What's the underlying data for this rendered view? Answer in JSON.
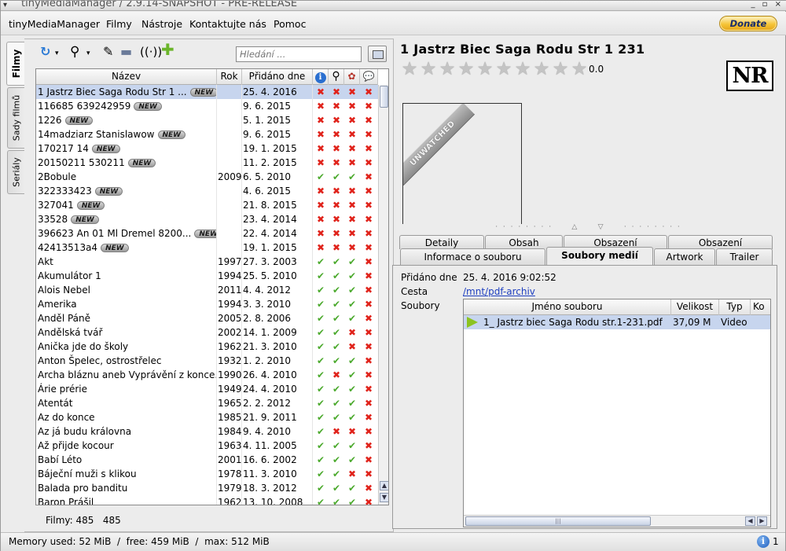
{
  "window": {
    "title": "tinyMediaManager / 2.9.14-SNAPSHOT - PRE-RELEASE",
    "controls": "_ ▫ ×"
  },
  "menu": {
    "items": [
      "tinyMediaManager",
      "Filmy",
      "Nástroje",
      "Kontaktujte nás",
      "Pomoc"
    ],
    "donate": "Donate"
  },
  "side_tabs": [
    "Filmy",
    "Sady filmů",
    "Seriály"
  ],
  "search": {
    "placeholder": "Hledání ..."
  },
  "table": {
    "headers": {
      "name": "Název",
      "year": "Rok",
      "added": "Přidáno dne"
    },
    "new_badge": "NEW",
    "rows": [
      {
        "name": "1 Jastrz Biec Saga Rodu Str 1 ...",
        "new": true,
        "year": "",
        "date": "25. 4. 2016",
        "f": "xxxx",
        "sel": true
      },
      {
        "name": "116685 639242959",
        "new": true,
        "year": "",
        "date": "9. 6. 2015",
        "f": "xxxx"
      },
      {
        "name": "1226",
        "new": true,
        "year": "",
        "date": "5. 1. 2015",
        "f": "xxxx"
      },
      {
        "name": "14madziarz Stanislawow",
        "new": true,
        "year": "",
        "date": "9. 6. 2015",
        "f": "xxxx"
      },
      {
        "name": "170217 14",
        "new": true,
        "year": "",
        "date": "19. 1. 2015",
        "f": "xxxx"
      },
      {
        "name": "20150211 530211",
        "new": true,
        "year": "",
        "date": "11. 2. 2015",
        "f": "xxxx"
      },
      {
        "name": "2Bobule",
        "new": false,
        "year": "2009",
        "date": "6. 5. 2010",
        "f": "vvvx"
      },
      {
        "name": "322333423",
        "new": true,
        "year": "",
        "date": "4. 6. 2015",
        "f": "xxxx"
      },
      {
        "name": "327041",
        "new": true,
        "year": "",
        "date": "21. 8. 2015",
        "f": "xxxx"
      },
      {
        "name": "33528",
        "new": true,
        "year": "",
        "date": "23. 4. 2014",
        "f": "xxxx"
      },
      {
        "name": "396623 An 01 Ml Dremel 8200...",
        "new": true,
        "year": "",
        "date": "22. 4. 2014",
        "f": "xxxx"
      },
      {
        "name": "42413513a4",
        "new": true,
        "year": "",
        "date": "19. 1. 2015",
        "f": "xxxx"
      },
      {
        "name": "Akt",
        "new": false,
        "year": "1997",
        "date": "27. 3. 2003",
        "f": "vvvx"
      },
      {
        "name": "Akumulátor 1",
        "new": false,
        "year": "1994",
        "date": "25. 5. 2010",
        "f": "vvvx"
      },
      {
        "name": "Alois Nebel",
        "new": false,
        "year": "2011",
        "date": "4. 4. 2012",
        "f": "vvvx"
      },
      {
        "name": "Amerika",
        "new": false,
        "year": "1994",
        "date": "3. 3. 2010",
        "f": "vvvx"
      },
      {
        "name": "Anděl Páně",
        "new": false,
        "year": "2005",
        "date": "2. 8. 2006",
        "f": "vvvx"
      },
      {
        "name": "Andělská tvář",
        "new": false,
        "year": "2002",
        "date": "14. 1. 2009",
        "f": "vvxx"
      },
      {
        "name": "Anička jde do školy",
        "new": false,
        "year": "1962",
        "date": "21. 3. 2010",
        "f": "vvxx"
      },
      {
        "name": "Anton Špelec, ostrostřelec",
        "new": false,
        "year": "1932",
        "date": "1. 2. 2010",
        "f": "vvvx"
      },
      {
        "name": "Archa bláznu aneb Vyprávění z konce...",
        "new": false,
        "year": "1990",
        "date": "26. 4. 2010",
        "f": "vxvx"
      },
      {
        "name": "Árie prérie",
        "new": false,
        "year": "1949",
        "date": "24. 4. 2010",
        "f": "vvvx"
      },
      {
        "name": "Atentát",
        "new": false,
        "year": "1965",
        "date": "2. 2. 2012",
        "f": "vvvx"
      },
      {
        "name": "Az do konce",
        "new": false,
        "year": "1985",
        "date": "21. 9. 2011",
        "f": "vvvx"
      },
      {
        "name": "Az já budu královna",
        "new": false,
        "year": "1984",
        "date": "9. 4. 2010",
        "f": "vxxx"
      },
      {
        "name": "Až přijde kocour",
        "new": false,
        "year": "1963",
        "date": "4. 11. 2005",
        "f": "vvvx"
      },
      {
        "name": "Babí Léto",
        "new": false,
        "year": "2001",
        "date": "16. 6. 2002",
        "f": "vvvx"
      },
      {
        "name": "Báječní muži s klikou",
        "new": false,
        "year": "1978",
        "date": "11. 3. 2010",
        "f": "vvxx"
      },
      {
        "name": "Balada pro banditu",
        "new": false,
        "year": "1979",
        "date": "18. 3. 2012",
        "f": "vvvx"
      },
      {
        "name": "Baron Prášil",
        "new": false,
        "year": "1962",
        "date": "13. 10. 2008",
        "f": "vvvx"
      }
    ]
  },
  "counts": {
    "label": "Filmy:",
    "value": "485   485"
  },
  "detail": {
    "title": "1 Jastrz Biec Saga Rodu Str 1 231",
    "rating": "0.0",
    "stars_total": 10,
    "certification": "NR",
    "ribbon": "UNWATCHED",
    "tabs_row1": [
      "Detaily",
      "Obsah",
      "Obsazení",
      "Obsazení"
    ],
    "tabs_row2": [
      "Informace o souboru",
      "Soubory medií",
      "Artwork",
      "Trailer"
    ],
    "added_label": "Přidáno dne",
    "added_value": "25. 4. 2016 9:02:52",
    "path_label": "Cesta",
    "path_value": "/mnt/pdf-archiv",
    "files_label": "Soubory",
    "file_headers": [
      "Jméno souboru",
      "Velikost",
      "Typ",
      "Ko"
    ],
    "file": {
      "name": "1_ Jastrz biec Saga Rodu str.1-231.pdf",
      "size": "37,09 M",
      "type": "Video"
    }
  },
  "status": {
    "memory": "Memory used: 52 MiB  /  free: 459 MiB  /  max: 512 MiB",
    "messages": "1"
  },
  "colors": {
    "ok": "#4caa2e",
    "missing": "#e0231b",
    "selection": "#c7d5ee"
  }
}
